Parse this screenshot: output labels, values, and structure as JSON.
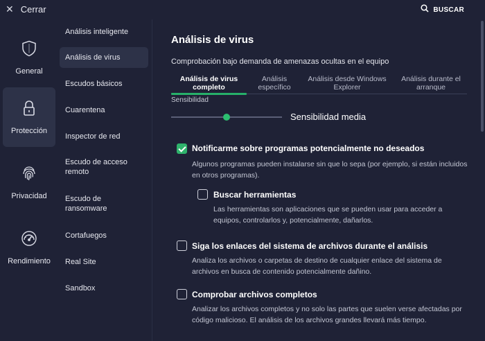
{
  "topbar": {
    "close_label": "Cerrar",
    "search_label": "BUSCAR"
  },
  "categories": [
    {
      "label": "General",
      "icon": "shield-icon",
      "active": false
    },
    {
      "label": "Protección",
      "icon": "lock-icon",
      "active": true
    },
    {
      "label": "Privacidad",
      "icon": "fingerprint-icon",
      "active": false
    },
    {
      "label": "Rendimiento",
      "icon": "speedometer-icon",
      "active": false
    }
  ],
  "subnav": {
    "items": [
      "Análisis inteligente",
      "Análisis de virus",
      "Escudos básicos",
      "Cuarentena",
      "Inspector de red",
      "Escudo de acceso remoto",
      "Escudo de ransomware",
      "Cortafuegos",
      "Real Site",
      "Sandbox"
    ],
    "active_index": 1
  },
  "main": {
    "title": "Análisis de virus",
    "subtitle": "Comprobación bajo demanda de amenazas ocultas en el equipo",
    "tabs": [
      {
        "label": "Análisis de virus completo",
        "active": true
      },
      {
        "label": "Análisis específico",
        "active": false
      },
      {
        "label": "Análisis desde Windows Explorer",
        "active": false
      },
      {
        "label": "Análisis durante el arranque",
        "active": false
      }
    ],
    "sensitivity": {
      "label": "Sensibilidad",
      "value_label": "Sensibilidad media",
      "level": 0.5
    },
    "options": {
      "pup": {
        "title": "Notificarme sobre programas potencialmente no deseados",
        "desc": "Algunos programas pueden instalarse sin que lo sepa (por ejemplo, si están incluidos en otros programas).",
        "checked": true
      },
      "tools": {
        "title": "Buscar herramientas",
        "desc": "Las herramientas son aplicaciones que se pueden usar para acceder a equipos, controlarlos y, potencialmente, dañarlos.",
        "checked": false
      },
      "links": {
        "title": "Siga los enlaces del sistema de archivos durante el análisis",
        "desc": "Analiza los archivos o carpetas de destino de cualquier enlace del sistema de archivos en busca de contenido potencialmente dañino.",
        "checked": false
      },
      "full": {
        "title": "Comprobar archivos completos",
        "desc": "Analizar los archivos completos y no solo las partes que suelen verse afectadas por código malicioso. El análisis de los archivos grandes llevará más tiempo.",
        "checked": false
      }
    }
  },
  "colors": {
    "background": "#1f2236",
    "panel_active": "#2d3248",
    "accent_green": "#2fb36c"
  }
}
